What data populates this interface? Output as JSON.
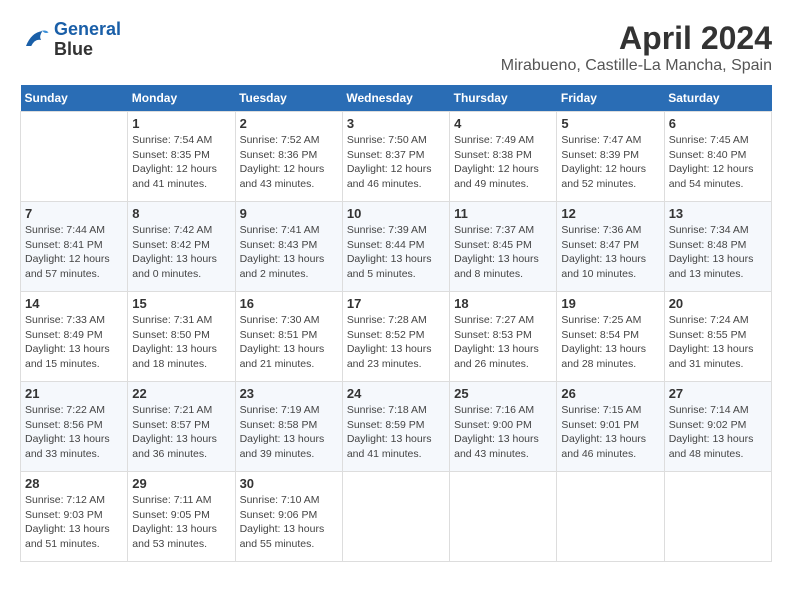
{
  "header": {
    "logo_line1": "General",
    "logo_line2": "Blue",
    "month": "April 2024",
    "location": "Mirabueno, Castille-La Mancha, Spain"
  },
  "weekdays": [
    "Sunday",
    "Monday",
    "Tuesday",
    "Wednesday",
    "Thursday",
    "Friday",
    "Saturday"
  ],
  "weeks": [
    [
      {
        "day": "",
        "info": ""
      },
      {
        "day": "1",
        "info": "Sunrise: 7:54 AM\nSunset: 8:35 PM\nDaylight: 12 hours\nand 41 minutes."
      },
      {
        "day": "2",
        "info": "Sunrise: 7:52 AM\nSunset: 8:36 PM\nDaylight: 12 hours\nand 43 minutes."
      },
      {
        "day": "3",
        "info": "Sunrise: 7:50 AM\nSunset: 8:37 PM\nDaylight: 12 hours\nand 46 minutes."
      },
      {
        "day": "4",
        "info": "Sunrise: 7:49 AM\nSunset: 8:38 PM\nDaylight: 12 hours\nand 49 minutes."
      },
      {
        "day": "5",
        "info": "Sunrise: 7:47 AM\nSunset: 8:39 PM\nDaylight: 12 hours\nand 52 minutes."
      },
      {
        "day": "6",
        "info": "Sunrise: 7:45 AM\nSunset: 8:40 PM\nDaylight: 12 hours\nand 54 minutes."
      }
    ],
    [
      {
        "day": "7",
        "info": "Sunrise: 7:44 AM\nSunset: 8:41 PM\nDaylight: 12 hours\nand 57 minutes."
      },
      {
        "day": "8",
        "info": "Sunrise: 7:42 AM\nSunset: 8:42 PM\nDaylight: 13 hours\nand 0 minutes."
      },
      {
        "day": "9",
        "info": "Sunrise: 7:41 AM\nSunset: 8:43 PM\nDaylight: 13 hours\nand 2 minutes."
      },
      {
        "day": "10",
        "info": "Sunrise: 7:39 AM\nSunset: 8:44 PM\nDaylight: 13 hours\nand 5 minutes."
      },
      {
        "day": "11",
        "info": "Sunrise: 7:37 AM\nSunset: 8:45 PM\nDaylight: 13 hours\nand 8 minutes."
      },
      {
        "day": "12",
        "info": "Sunrise: 7:36 AM\nSunset: 8:47 PM\nDaylight: 13 hours\nand 10 minutes."
      },
      {
        "day": "13",
        "info": "Sunrise: 7:34 AM\nSunset: 8:48 PM\nDaylight: 13 hours\nand 13 minutes."
      }
    ],
    [
      {
        "day": "14",
        "info": "Sunrise: 7:33 AM\nSunset: 8:49 PM\nDaylight: 13 hours\nand 15 minutes."
      },
      {
        "day": "15",
        "info": "Sunrise: 7:31 AM\nSunset: 8:50 PM\nDaylight: 13 hours\nand 18 minutes."
      },
      {
        "day": "16",
        "info": "Sunrise: 7:30 AM\nSunset: 8:51 PM\nDaylight: 13 hours\nand 21 minutes."
      },
      {
        "day": "17",
        "info": "Sunrise: 7:28 AM\nSunset: 8:52 PM\nDaylight: 13 hours\nand 23 minutes."
      },
      {
        "day": "18",
        "info": "Sunrise: 7:27 AM\nSunset: 8:53 PM\nDaylight: 13 hours\nand 26 minutes."
      },
      {
        "day": "19",
        "info": "Sunrise: 7:25 AM\nSunset: 8:54 PM\nDaylight: 13 hours\nand 28 minutes."
      },
      {
        "day": "20",
        "info": "Sunrise: 7:24 AM\nSunset: 8:55 PM\nDaylight: 13 hours\nand 31 minutes."
      }
    ],
    [
      {
        "day": "21",
        "info": "Sunrise: 7:22 AM\nSunset: 8:56 PM\nDaylight: 13 hours\nand 33 minutes."
      },
      {
        "day": "22",
        "info": "Sunrise: 7:21 AM\nSunset: 8:57 PM\nDaylight: 13 hours\nand 36 minutes."
      },
      {
        "day": "23",
        "info": "Sunrise: 7:19 AM\nSunset: 8:58 PM\nDaylight: 13 hours\nand 39 minutes."
      },
      {
        "day": "24",
        "info": "Sunrise: 7:18 AM\nSunset: 8:59 PM\nDaylight: 13 hours\nand 41 minutes."
      },
      {
        "day": "25",
        "info": "Sunrise: 7:16 AM\nSunset: 9:00 PM\nDaylight: 13 hours\nand 43 minutes."
      },
      {
        "day": "26",
        "info": "Sunrise: 7:15 AM\nSunset: 9:01 PM\nDaylight: 13 hours\nand 46 minutes."
      },
      {
        "day": "27",
        "info": "Sunrise: 7:14 AM\nSunset: 9:02 PM\nDaylight: 13 hours\nand 48 minutes."
      }
    ],
    [
      {
        "day": "28",
        "info": "Sunrise: 7:12 AM\nSunset: 9:03 PM\nDaylight: 13 hours\nand 51 minutes."
      },
      {
        "day": "29",
        "info": "Sunrise: 7:11 AM\nSunset: 9:05 PM\nDaylight: 13 hours\nand 53 minutes."
      },
      {
        "day": "30",
        "info": "Sunrise: 7:10 AM\nSunset: 9:06 PM\nDaylight: 13 hours\nand 55 minutes."
      },
      {
        "day": "",
        "info": ""
      },
      {
        "day": "",
        "info": ""
      },
      {
        "day": "",
        "info": ""
      },
      {
        "day": "",
        "info": ""
      }
    ]
  ]
}
